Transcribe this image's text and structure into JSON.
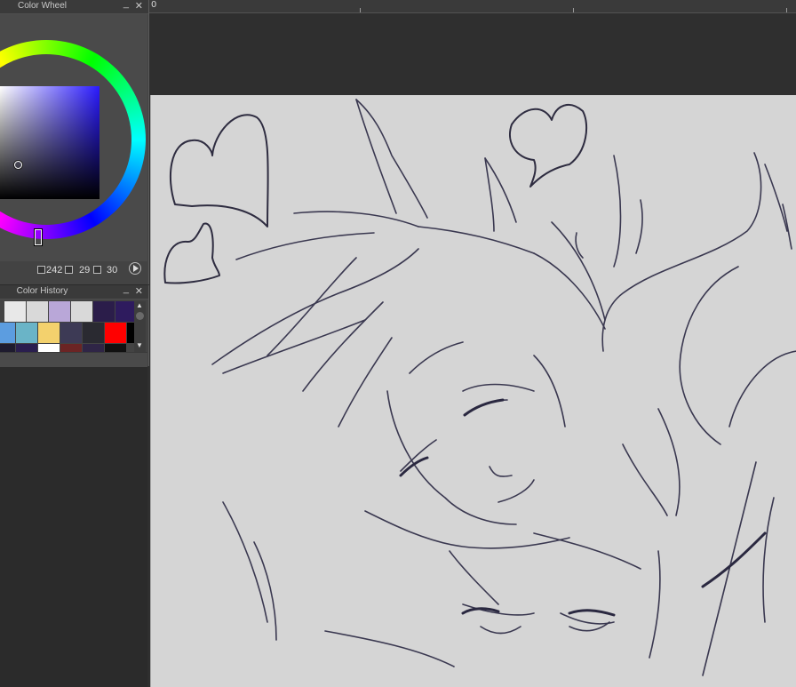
{
  "ruler": {
    "origin_label": "0"
  },
  "color_wheel_panel": {
    "title": "Color Wheel",
    "minimize_glyph": "_",
    "close_glyph": "✕",
    "hue": "242",
    "saturation": "29",
    "value": "30",
    "play_icon": "play-circle-icon"
  },
  "color_history_panel": {
    "title": "Color History",
    "minimize_glyph": "_",
    "close_glyph": "✕",
    "swatches": [
      "#e8e8e8",
      "#d9d9d9",
      "#b9a7d8",
      "#d9d9d9",
      "#2b1d4a",
      "#2e1b5e",
      "#5c9de0",
      "#6ab4c7",
      "#f3d16d",
      "#3d3a55",
      "#2a2a31",
      "#ff0000",
      "#000000",
      "#1e1b2e",
      "#2a1e4e",
      "#ffffff",
      "#6b2424",
      "#2f2546",
      "#111111"
    ]
  },
  "colors": {
    "canvas": "#d5d5d5",
    "line_art": "#2e2c40",
    "panel_bg": "#434343"
  }
}
